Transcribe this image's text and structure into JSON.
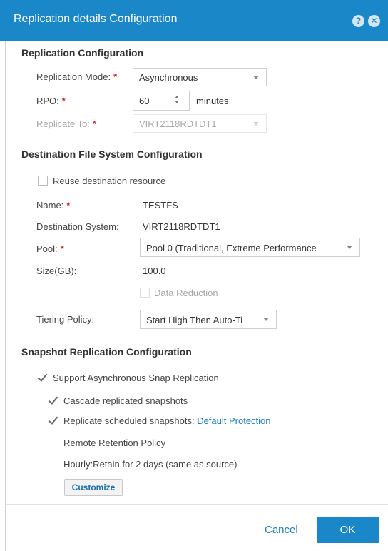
{
  "dialog": {
    "title": "Replication details Configuration",
    "help_glyph": "?",
    "close_glyph": "✕"
  },
  "replication": {
    "section_title": "Replication Configuration",
    "mode_label": "Replication Mode:",
    "mode_value": "Asynchronous",
    "rpo_label": "RPO:",
    "rpo_value": "60",
    "rpo_unit": "minutes",
    "replicate_to_label": "Replicate To:",
    "replicate_to_value": "VIRT2118RDTDT1",
    "required_mark": "*"
  },
  "destination": {
    "section_title": "Destination File System Configuration",
    "reuse_label": "Reuse destination resource",
    "name_label": "Name:",
    "name_value": "TESTFS",
    "system_label": "Destination System:",
    "system_value": "VIRT2118RDTDT1",
    "pool_label": "Pool:",
    "pool_value": "Pool 0 (Traditional, Extreme Performance",
    "size_label": "Size(GB):",
    "size_value": "100.0",
    "data_reduction_label": "Data Reduction",
    "tiering_label": "Tiering Policy:",
    "tiering_value": "Start High Then Auto-Ti"
  },
  "snapshot": {
    "section_title": "Snapshot Replication Configuration",
    "support_label": "Support Asynchronous Snap Replication",
    "cascade_label": "Cascade replicated snapshots",
    "scheduled_label": "Replicate scheduled snapshots:",
    "scheduled_link": "Default Protection",
    "retention_title": "Remote Retention Policy",
    "retention_text": "Hourly:Retain for 2 days (same as source)",
    "customize_label": "Customize"
  },
  "footer": {
    "cancel_label": "Cancel",
    "ok_label": "OK"
  },
  "colors": {
    "accent": "#1a87c8",
    "required": "#e02020",
    "link": "#1a7dc4"
  }
}
